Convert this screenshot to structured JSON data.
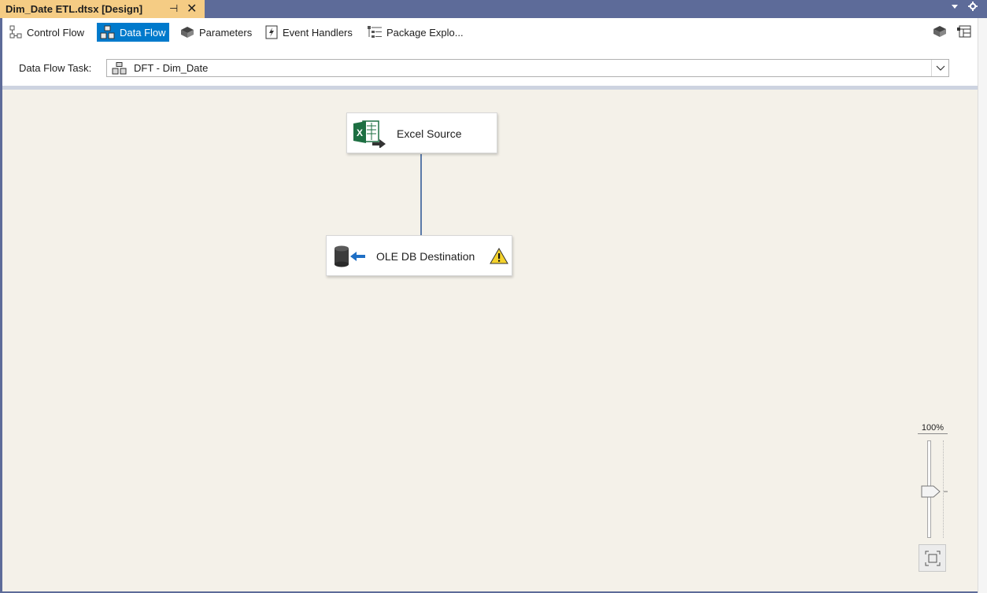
{
  "document_tab": {
    "title": "Dim_Date ETL.dtsx [Design]",
    "pin_glyph": "⊣",
    "close_glyph": "✕"
  },
  "toolbar": {
    "tabs": [
      {
        "label": "Control Flow",
        "icon": "control-flow-icon",
        "active": false
      },
      {
        "label": "Data Flow",
        "icon": "data-flow-icon",
        "active": true
      },
      {
        "label": "Parameters",
        "icon": "parameters-icon",
        "active": false
      },
      {
        "label": "Event Handlers",
        "icon": "event-handlers-icon",
        "active": false
      },
      {
        "label": "Package Explo...",
        "icon": "package-explorer-icon",
        "active": false
      }
    ],
    "right_icons": [
      "variables-icon",
      "toolbox-icon"
    ]
  },
  "task": {
    "label": "Data Flow Task:",
    "selected": "DFT - Dim_Date"
  },
  "canvas": {
    "components": [
      {
        "label": "Excel Source",
        "icon": "excel-source-icon",
        "warning": false
      },
      {
        "label": "OLE DB Destination",
        "icon": "oledb-destination-icon",
        "warning": true
      }
    ]
  },
  "zoom": {
    "level": "100%"
  },
  "colors": {
    "active_tab": "#007acc",
    "document_tab": "#f5cc84",
    "canvas": "#f4f1e9",
    "connector": "#5b7aa8"
  }
}
